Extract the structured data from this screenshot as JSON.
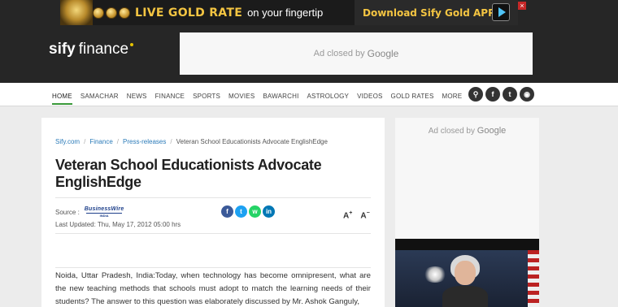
{
  "top_ad": {
    "headline": "LIVE GOLD RATE",
    "subline": "on your fingertip",
    "cta": "Download Sify Gold APP",
    "close_label": "×"
  },
  "logo": {
    "brand": "sify",
    "product": "finance"
  },
  "header_ad": {
    "text": "Ad closed by",
    "provider": "Google"
  },
  "nav": {
    "items": [
      "HOME",
      "SAMACHAR",
      "NEWS",
      "FINANCE",
      "SPORTS",
      "MOVIES",
      "BAWARCHI",
      "ASTROLOGY",
      "VIDEOS",
      "GOLD RATES",
      "MORE"
    ],
    "active_index": 0
  },
  "social": {
    "icons": [
      "search-icon",
      "facebook-icon",
      "twitter-icon",
      "rss-icon"
    ],
    "glyphs": [
      "⚲",
      "f",
      "t",
      "◉"
    ]
  },
  "breadcrumb": [
    "Sify.com",
    "Finance",
    "Press-releases",
    "Veteran School Educationists Advocate EnglishEdge"
  ],
  "article": {
    "title": "Veteran School Educationists Advocate EnglishEdge",
    "source_label": "Source :",
    "source_name": "BusinessWire",
    "source_region": "INDIA",
    "last_updated": "Last Updated: Thu, May 17, 2012 05:00 hrs",
    "font_increase": "A",
    "font_decrease": "A",
    "body": "Noida, Uttar Pradesh, India:Today, when technology has become omnipresent, what are the new teaching methods that schools must adopt to match the learning needs of their students? The answer to this question was elaborately discussed by Mr. Ashok Ganguly,"
  },
  "share": [
    {
      "name": "facebook-icon",
      "glyph": "f",
      "color": "#3b5998"
    },
    {
      "name": "twitter-icon",
      "glyph": "t",
      "color": "#1da1f2"
    },
    {
      "name": "whatsapp-icon",
      "glyph": "w",
      "color": "#25d366"
    },
    {
      "name": "linkedin-icon",
      "glyph": "in",
      "color": "#0077b5"
    }
  ],
  "side_ad": {
    "text": "Ad closed by",
    "provider": "Google"
  },
  "colors": {
    "accent": "#3a9a3a",
    "header_bg": "#262626",
    "gold": "#f4c542",
    "link": "#2b7bb9"
  }
}
